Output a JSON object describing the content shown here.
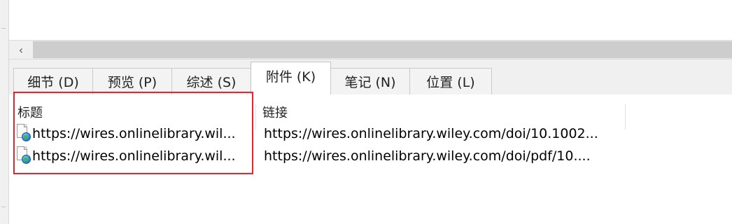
{
  "horizontal_scrollbar": {
    "left_arrow": "‹"
  },
  "tabs": [
    {
      "label": "细节 (D)",
      "active": false
    },
    {
      "label": "预览 (P)",
      "active": false
    },
    {
      "label": "综述 (S)",
      "active": false
    },
    {
      "label": "附件 (K)",
      "active": true
    },
    {
      "label": "笔记 (N)",
      "active": false
    },
    {
      "label": "位置 (L)",
      "active": false
    }
  ],
  "attachments": {
    "columns": {
      "title": "标题",
      "link": "链接"
    },
    "rows": [
      {
        "icon": "web-document-icon",
        "title": "https://wires.onlinelibrary.wil...",
        "link": "https://wires.onlinelibrary.wiley.com/doi/10.1002..."
      },
      {
        "icon": "web-document-icon",
        "title": "https://wires.onlinelibrary.wil...",
        "link": "https://wires.onlinelibrary.wiley.com/doi/pdf/10...."
      }
    ]
  },
  "colors": {
    "highlight_border": "#e0262e",
    "tab_border": "#b9c4d1"
  }
}
